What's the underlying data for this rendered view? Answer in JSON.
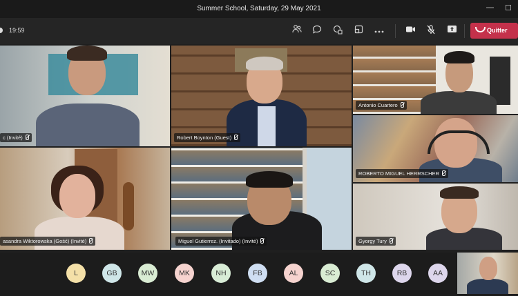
{
  "window": {
    "title": "Summer School, Saturday, 29 May 2021",
    "minimize": "—",
    "maximize": "☐"
  },
  "toolbar": {
    "timer": "19:59",
    "icons": [
      "people-icon",
      "chat-icon",
      "reactions-icon",
      "rooms-icon",
      "more-icon",
      "camera-icon",
      "mic-muted-icon",
      "share-icon"
    ],
    "leave_label": "Quitter",
    "leave_color": "#c4314b"
  },
  "tiles": [
    {
      "name": "c (Invité)"
    },
    {
      "name": "Robert Boynton (Guest)"
    },
    {
      "name": "Antonio Cuartero"
    },
    {
      "name": "ROBERTO MIGUEL HERRSCHER"
    },
    {
      "name": "asandra Wiktorowska (Gość) (Invité)"
    },
    {
      "name": "Miguel Gutierrez. (Invitado) (Invité)"
    },
    {
      "name": "Gyorgy Tury"
    }
  ],
  "avatars": [
    {
      "initials": "L",
      "color": "#f4e0a8"
    },
    {
      "initials": "GB",
      "color": "#cfe6e8"
    },
    {
      "initials": "MW",
      "color": "#d9ecd3"
    },
    {
      "initials": "MK",
      "color": "#f6d3cf"
    },
    {
      "initials": "NH",
      "color": "#d8ecd6"
    },
    {
      "initials": "FB",
      "color": "#cfdef2"
    },
    {
      "initials": "AL",
      "color": "#f6d3cf"
    },
    {
      "initials": "SC",
      "color": "#d9ecd3"
    },
    {
      "initials": "TH",
      "color": "#cfe6e8"
    },
    {
      "initials": "RB",
      "color": "#ddd6ec"
    },
    {
      "initials": "AA",
      "color": "#ddd6ec"
    }
  ]
}
